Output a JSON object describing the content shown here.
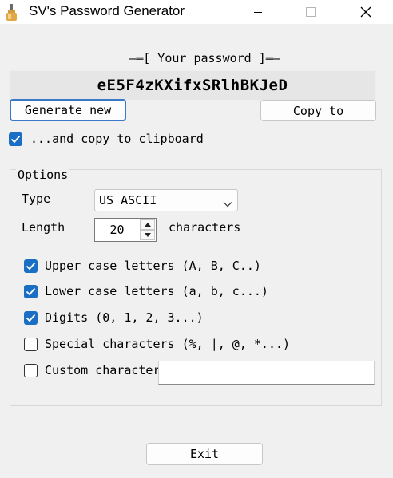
{
  "window": {
    "title": "SV's Password Generator",
    "icon": "app-icon"
  },
  "password": {
    "header": "—═[ Your password ]═—",
    "value": "eE5F4zKXifxSRlhBKJeD"
  },
  "buttons": {
    "generate_label": "Generate new",
    "copy_label": "Copy to",
    "exit_label": "Exit"
  },
  "copy_clipboard": {
    "label": "...and copy to clipboard",
    "checked": true
  },
  "options": {
    "title": "Options",
    "type_label": "Type",
    "type_value": "US ASCII",
    "length_label": "Length",
    "length_value": "20",
    "length_unit": "characters",
    "checkboxes": [
      {
        "label": "Upper case letters (A, B, C..)",
        "checked": true
      },
      {
        "label": "Lower case letters (a, b, c...)",
        "checked": true
      },
      {
        "label": "Digits (0, 1, 2, 3...)",
        "checked": true
      },
      {
        "label": "Special characters (%, |, @, *...)",
        "checked": false
      },
      {
        "label": "Custom character",
        "checked": false
      }
    ],
    "custom_input_value": ""
  },
  "colors": {
    "accent": "#1a6fc4",
    "focus_border": "#3a79c8",
    "background": "#f0f0f0"
  }
}
